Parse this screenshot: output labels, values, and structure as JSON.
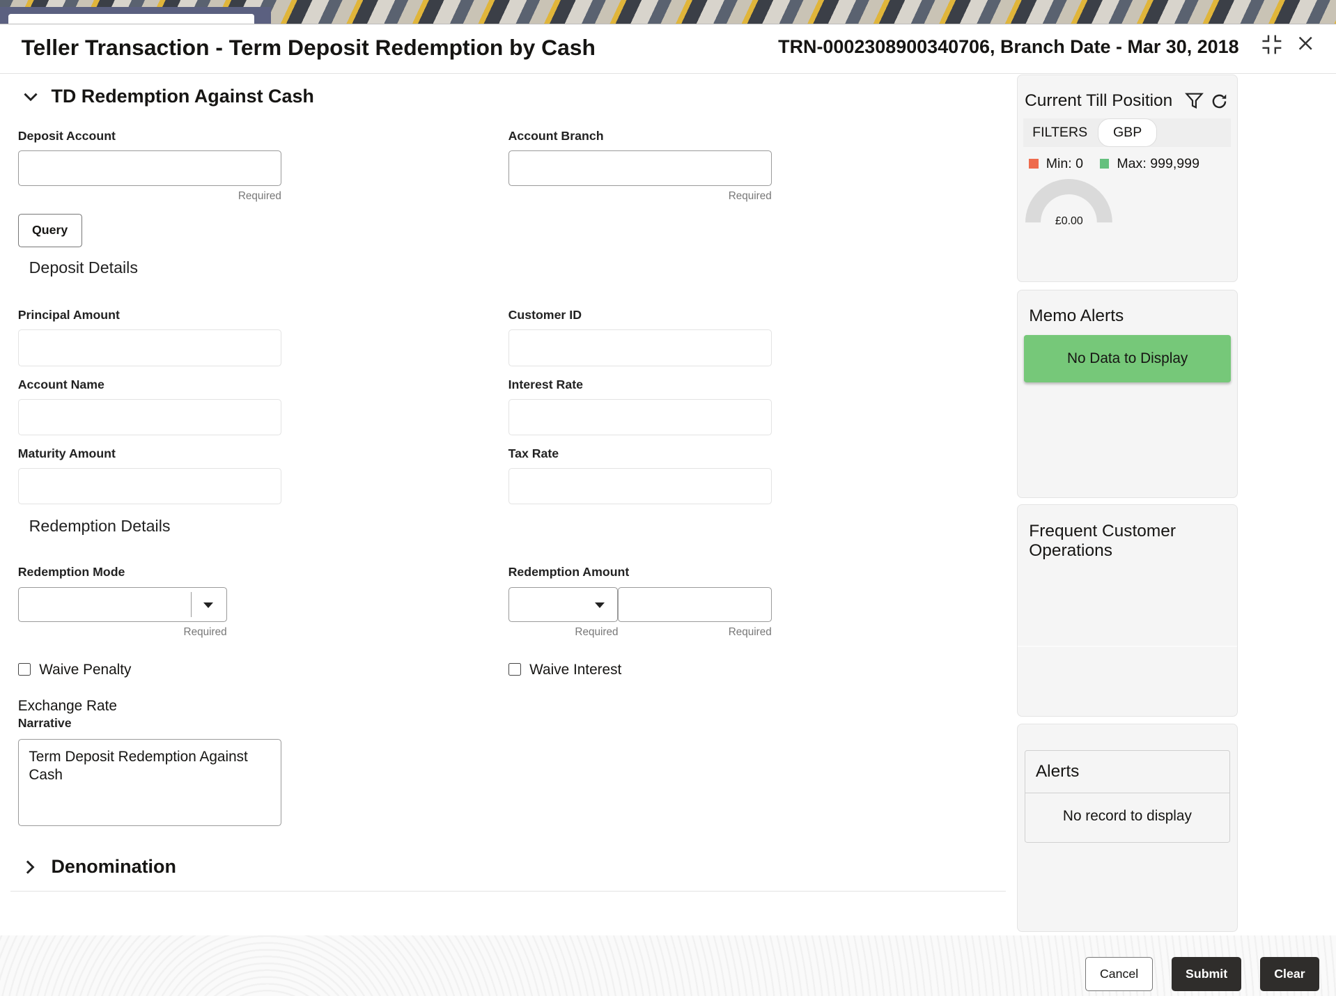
{
  "header": {
    "title": "Teller Transaction - Term Deposit Redemption by Cash",
    "reference": "TRN-0002308900340706, Branch Date - Mar 30, 2018"
  },
  "section": {
    "title": "TD Redemption Against Cash"
  },
  "fields": {
    "deposit_account": {
      "label": "Deposit Account",
      "value": "",
      "hint": "Required"
    },
    "account_branch": {
      "label": "Account Branch",
      "value": "",
      "hint": "Required"
    },
    "query_label": "Query",
    "deposit_details_title": "Deposit Details",
    "principal_amount": {
      "label": "Principal Amount",
      "value": ""
    },
    "customer_id": {
      "label": "Customer ID",
      "value": ""
    },
    "account_name": {
      "label": "Account Name",
      "value": ""
    },
    "interest_rate": {
      "label": "Interest Rate",
      "value": ""
    },
    "maturity_amount": {
      "label": "Maturity Amount",
      "value": ""
    },
    "tax_rate": {
      "label": "Tax Rate",
      "value": ""
    },
    "redemption_details_title": "Redemption Details",
    "redemption_mode": {
      "label": "Redemption Mode",
      "value": "",
      "hint": "Required"
    },
    "redemption_amount": {
      "label": "Redemption Amount",
      "currency": "",
      "amount": "",
      "hint_currency": "Required",
      "hint_amount": "Required"
    },
    "waive_penalty": {
      "label": "Waive Penalty",
      "checked": false
    },
    "waive_interest": {
      "label": "Waive Interest",
      "checked": false
    },
    "exchange_rate": {
      "label": "Exchange Rate"
    },
    "narrative": {
      "label": "Narrative",
      "value": "Term Deposit Redemption Against Cash"
    }
  },
  "denomination": {
    "title": "Denomination"
  },
  "till": {
    "title": "Current Till Position",
    "filters_label": "FILTERS",
    "currency": "GBP",
    "min_label": "Min: 0",
    "max_label": "Max: 999,999",
    "gauge_value": "£0.00",
    "min_color": "#ee6b4d",
    "max_color": "#65c07e"
  },
  "memo": {
    "title": "Memo Alerts",
    "empty": "No Data to Display",
    "color": "#76c879"
  },
  "frequent": {
    "title": "Frequent Customer Operations"
  },
  "alerts": {
    "title": "Alerts",
    "empty": "No record to display"
  },
  "footer": {
    "cancel": "Cancel",
    "submit": "Submit",
    "clear": "Clear"
  }
}
